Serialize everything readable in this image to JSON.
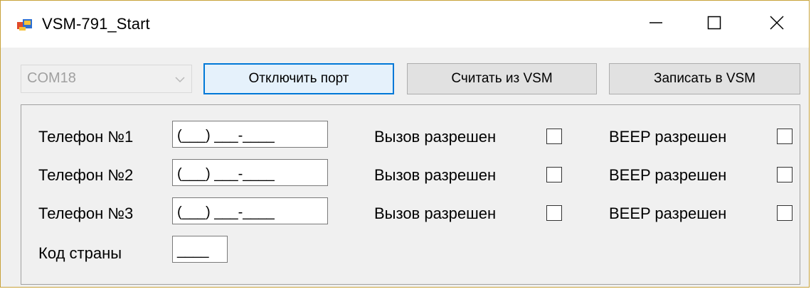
{
  "window": {
    "title": "VSM-791_Start",
    "controls": {
      "minimize": "minimize-icon",
      "maximize": "maximize-icon",
      "close": "close-icon"
    }
  },
  "toolbar": {
    "port": {
      "value": "COM18",
      "disabled": true
    },
    "disconnect_label": "Отключить порт",
    "read_label": "Считать из VSM",
    "write_label": "Записать в VSM"
  },
  "phones": [
    {
      "label": "Телефон №1",
      "mask": "(___) ___-____",
      "call_label": "Вызов разрешен",
      "call_checked": false,
      "beep_label": "BEEP разрешен",
      "beep_checked": false
    },
    {
      "label": "Телефон №2",
      "mask": "(___) ___-____",
      "call_label": "Вызов разрешен",
      "call_checked": false,
      "beep_label": "BEEP разрешен",
      "beep_checked": false
    },
    {
      "label": "Телефон №3",
      "mask": "(___) ___-____",
      "call_label": "Вызов разрешен",
      "call_checked": false,
      "beep_label": "BEEP разрешен",
      "beep_checked": false
    }
  ],
  "country": {
    "label": "Код страны",
    "mask": "____"
  },
  "colors": {
    "accent": "#0078d7",
    "frame": "#c8a23a",
    "background": "#f0f0f0"
  }
}
